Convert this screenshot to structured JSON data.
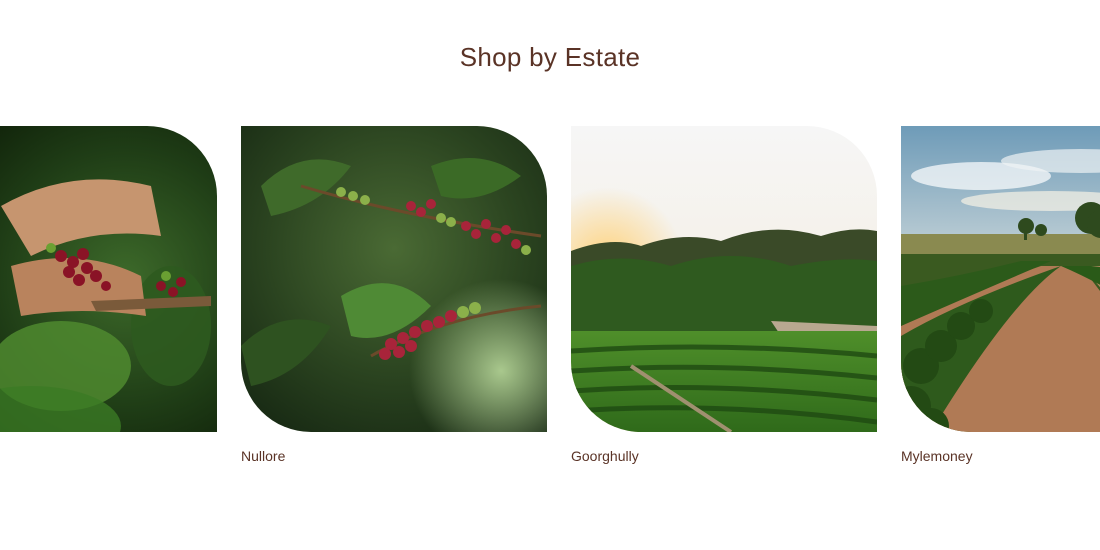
{
  "section": {
    "title": "Shop by Estate"
  },
  "estates": [
    {
      "label": "",
      "image": "coffee-picking-photo"
    },
    {
      "label": "Nullore",
      "image": "coffee-cherries-photo"
    },
    {
      "label": "Goorghully",
      "image": "sunset-plantation-photo"
    },
    {
      "label": "Mylemoney",
      "image": "plantation-rows-photo"
    }
  ],
  "colors": {
    "heading": "#5a3326",
    "label": "#5a3326",
    "background": "#ffffff"
  }
}
